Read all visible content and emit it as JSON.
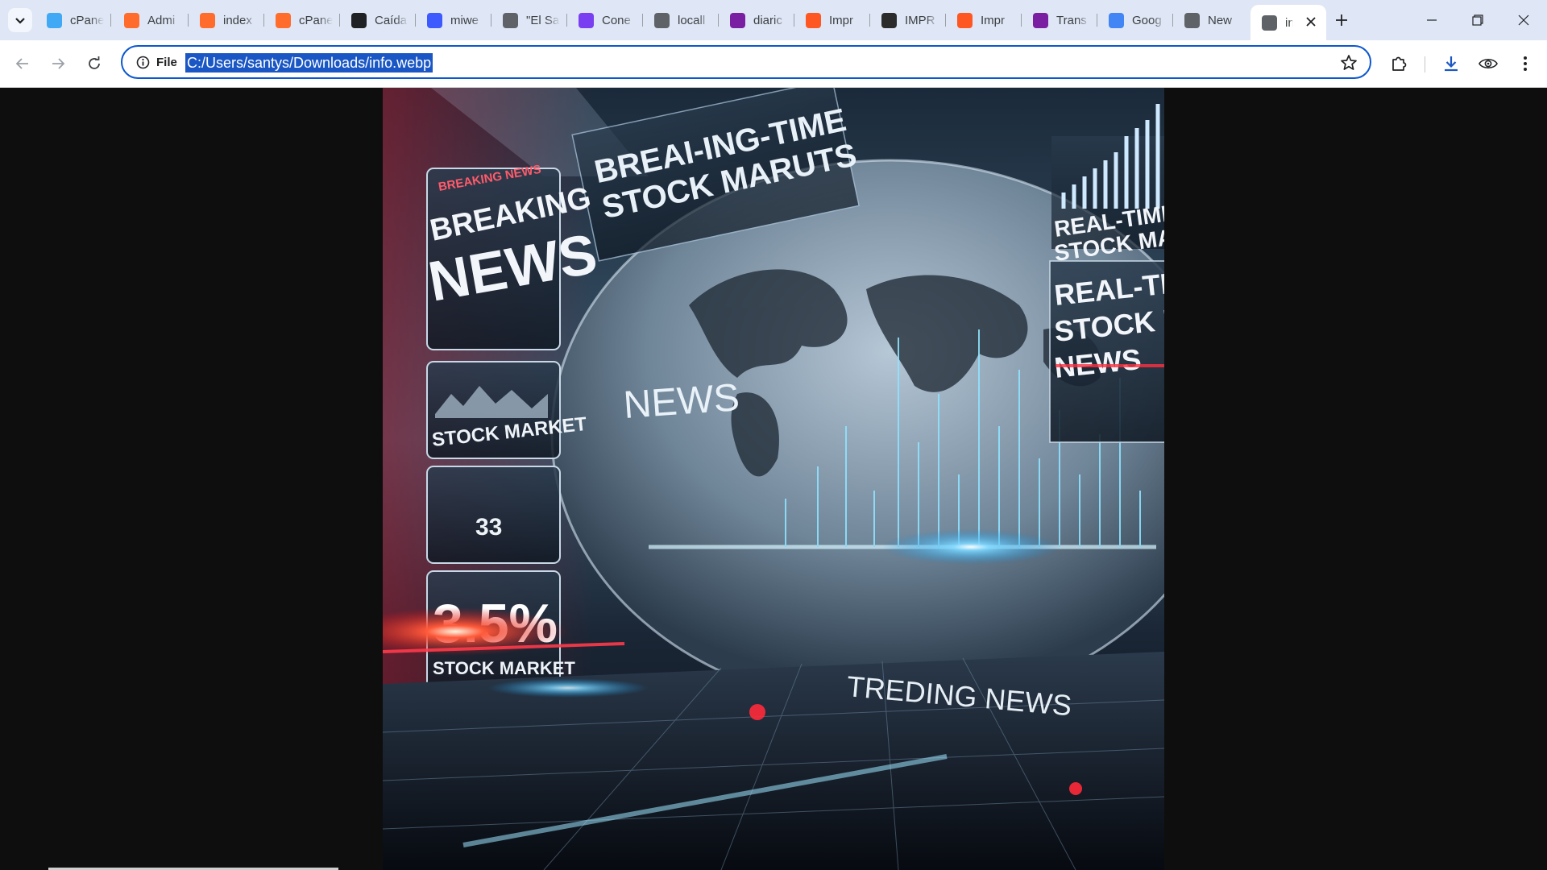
{
  "tabs": [
    {
      "label": "cPane",
      "icon": "cpanel-swirl-icon",
      "color": "#3fa9f5"
    },
    {
      "label": "Admi",
      "icon": "cpanel-logo-icon",
      "color": "#ff6c2c"
    },
    {
      "label": "index",
      "icon": "cpanel-logo-icon",
      "color": "#ff6c2c"
    },
    {
      "label": "cPane",
      "icon": "cpanel-logo-icon",
      "color": "#ff6c2c"
    },
    {
      "label": "Caída",
      "icon": "openai-icon",
      "color": "#202124"
    },
    {
      "label": "miwe",
      "icon": "chat-bubble-icon",
      "color": "#3d5afe"
    },
    {
      "label": "\"El Sa",
      "icon": "globe-icon",
      "color": "#5f6368"
    },
    {
      "label": "Cone",
      "icon": "gradient-app-icon",
      "color": "#7b3ff2"
    },
    {
      "label": "locall",
      "icon": "globe-icon",
      "color": "#5f6368"
    },
    {
      "label": "diaric",
      "icon": "yoast-icon",
      "color": "#7b1fa2"
    },
    {
      "label": "Impr",
      "icon": "flame-icon",
      "color": "#ff5722"
    },
    {
      "label": "IMPR",
      "icon": "dark-square-icon",
      "color": "#2b2b2b"
    },
    {
      "label": "Impr",
      "icon": "flame-icon",
      "color": "#ff5722"
    },
    {
      "label": "Trans",
      "icon": "yoast-icon",
      "color": "#7b1fa2"
    },
    {
      "label": "Goog",
      "icon": "google-translate-icon",
      "color": "#4285f4"
    },
    {
      "label": "New",
      "icon": "globe-icon",
      "color": "#5f6368"
    },
    {
      "label": "info.webp",
      "icon": "globe-icon",
      "color": "#5f6368"
    }
  ],
  "toolbar": {
    "site_chip": "File",
    "url": "C:/Users/santys/Downloads/info.webp"
  },
  "image": {
    "texts": {
      "breaking_small": "BREAKING NEWS",
      "breaking_1": "BREAKING",
      "breaking_2": "NEWS",
      "stock_market_1": "STOCK MARKET",
      "num_33": "33",
      "percent": "3.5%",
      "stock_market_2": "STOCK MARKET",
      "top_1": "BREAI-ING-TIME",
      "top_2": "STOCK MARUTS",
      "news_globe": "NEWS",
      "right_1a": "REAL-TIME",
      "right_1b": "STOCK MAR",
      "right_2a": "REAL-TIN",
      "right_2b": "STOCK M",
      "right_2c": "NEWS",
      "trending": "TREDING NEWS"
    }
  }
}
